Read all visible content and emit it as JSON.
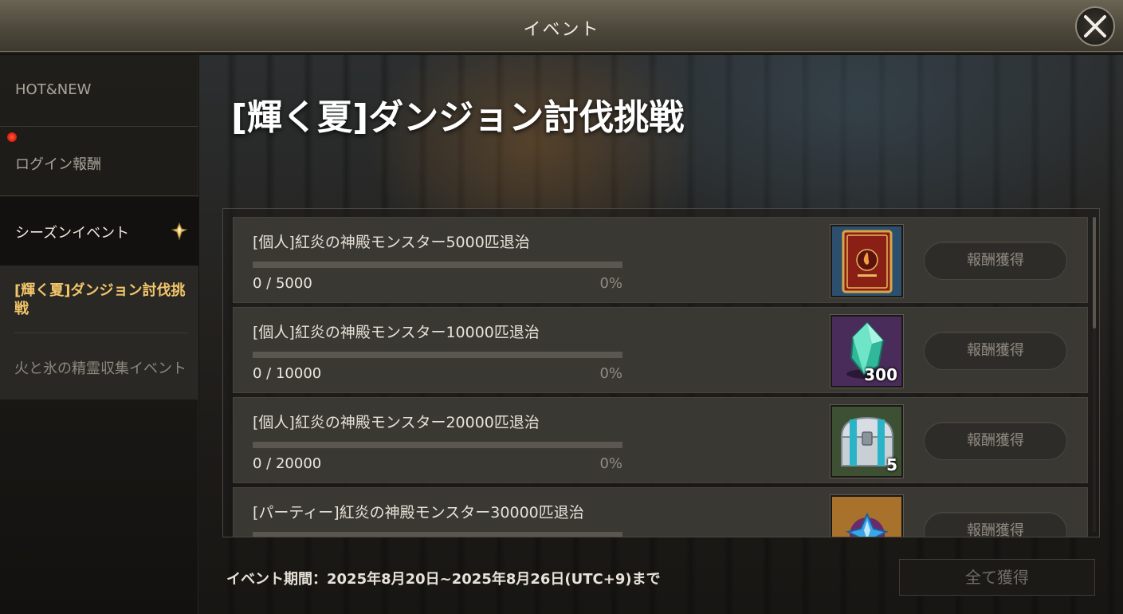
{
  "window": {
    "title": "イベント",
    "close_icon": "close-x-icon"
  },
  "sidebar": {
    "items": [
      {
        "label": "HOT&NEW"
      },
      {
        "label": "ログイン報酬",
        "badge": "red-dot"
      },
      {
        "label": "シーズンイベント",
        "icon": "diamond-gem-icon"
      }
    ],
    "sub_items": [
      {
        "label": "[輝く夏]ダンジョン討伐挑戦",
        "active": true
      },
      {
        "label": "火と氷の精霊収集イベント"
      }
    ]
  },
  "main": {
    "event_title": "[輝く夏]ダンジョン討伐挑戦",
    "missions": [
      {
        "title": "[個人]紅炎の神殿モンスター5000匹退治",
        "progress": "0 / 5000",
        "percent": "0%",
        "fill": 0,
        "reward_icon": "red-book-icon",
        "reward_qty": "",
        "claim_label": "報酬獲得"
      },
      {
        "title": "[個人]紅炎の神殿モンスター10000匹退治",
        "progress": "0 / 10000",
        "percent": "0%",
        "fill": 0,
        "reward_icon": "green-crystal-icon",
        "reward_qty": "300",
        "claim_label": "報酬獲得"
      },
      {
        "title": "[個人]紅炎の神殿モンスター20000匹退治",
        "progress": "0 / 20000",
        "percent": "0%",
        "fill": 0,
        "reward_icon": "silver-chest-icon",
        "reward_qty": "5",
        "claim_label": "報酬獲得"
      },
      {
        "title": "[パーティー]紅炎の神殿モンスター30000匹退治",
        "progress": "",
        "percent": "",
        "fill": 0,
        "reward_icon": "blue-spiky-orb-icon",
        "reward_qty": "",
        "claim_label": "報酬獲得"
      }
    ],
    "period": "イベント期間：2025年8月20日~2025年8月26日(UTC+9)まで",
    "claim_all_label": "全て獲得"
  },
  "colors": {
    "accent_gold": "#f2c56a",
    "active_row_bg": "#3a3833"
  }
}
